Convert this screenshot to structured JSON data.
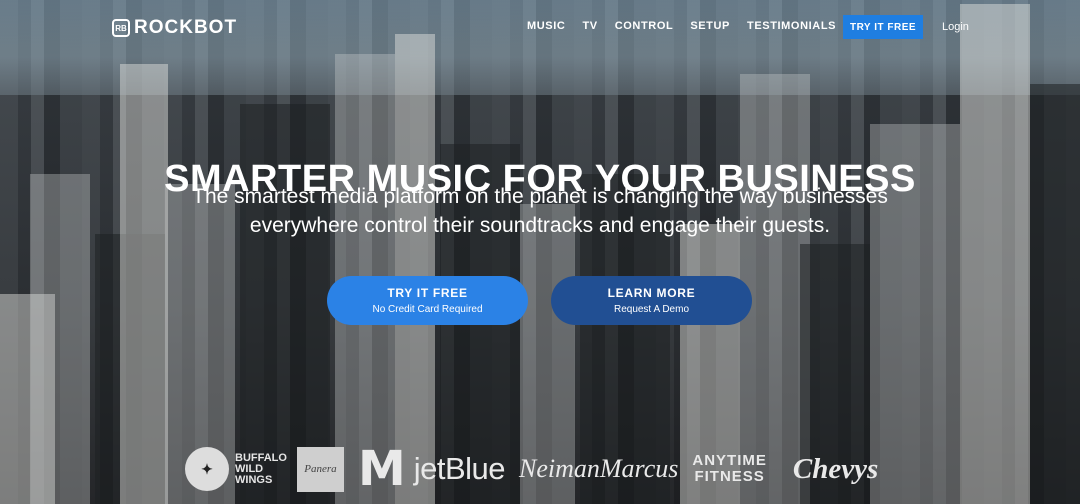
{
  "brand": {
    "name": "ROCKBOT",
    "mark": "RB"
  },
  "nav": {
    "items": [
      {
        "label": "MUSIC"
      },
      {
        "label": "TV"
      },
      {
        "label": "CONTROL"
      },
      {
        "label": "SETUP"
      },
      {
        "label": "TESTIMONIALS"
      }
    ],
    "cta_label": "TRY IT FREE",
    "login_label": "Login"
  },
  "hero": {
    "headline": "SMARTER MUSIC FOR YOUR BUSINESS",
    "subline_1": "The smartest media platform on the planet is changing the way businesses",
    "subline_2": "everywhere control their soundtracks and engage their guests.",
    "try_button": {
      "title": "TRY IT FREE",
      "subtitle": "No Credit Card Required"
    },
    "learn_button": {
      "title": "LEARN MORE",
      "subtitle": "Request A Demo"
    }
  },
  "customers": {
    "buffalo_wild_wings": {
      "line1": "BUFFALO",
      "line2": "WILD",
      "line3": "WINGS",
      "icon": "buffalo-wild-wings-logo-icon"
    },
    "panera": {
      "text": "Panera",
      "icon": "panera-logo-icon"
    },
    "mcdonalds": {
      "text": "M",
      "icon": "mcdonalds-logo-icon"
    },
    "jetblue": {
      "text": "jetBlue"
    },
    "neiman_marcus": {
      "text": "NeimanMarcus"
    },
    "anytime_fitness": {
      "line1": "ANYTIME",
      "line2": "FITNESS"
    },
    "chevys": {
      "text": "Chevys"
    }
  },
  "colors": {
    "accent_blue": "#2b82e6",
    "dark_blue": "#214f93",
    "nav_cta": "#1f7ee1"
  }
}
